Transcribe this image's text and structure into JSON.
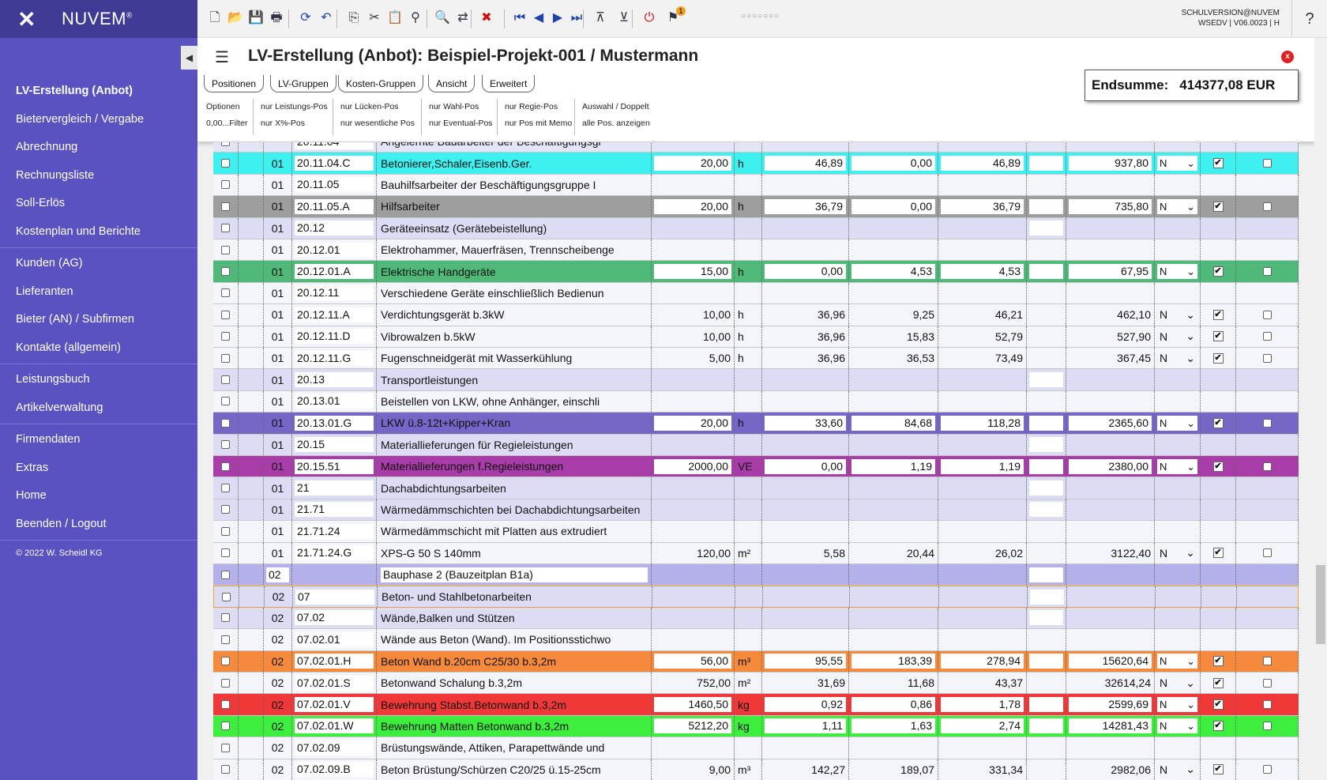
{
  "app": {
    "name": "NUVEM",
    "trademark": "®",
    "version_line1": "SCHULVERSION@NUVEM",
    "version_line2": "WSEDV | V06.0023 | H",
    "help": "?"
  },
  "page_title": "LV-Erstellung (Anbot): Beispiel-Projekt-001 / Mustermann",
  "close_label": "x",
  "endsum": {
    "label": "Endsumme:",
    "value": "414377,08 EUR"
  },
  "sidebar": {
    "groups": [
      [
        {
          "label": "LV-Erstellung (Anbot)",
          "active": true
        },
        {
          "label": "Bietervergleich / Vergabe"
        },
        {
          "label": "Abrechnung"
        },
        {
          "label": "Rechnungsliste"
        },
        {
          "label": "Soll-Erlös"
        },
        {
          "label": "Kostenplan und Berichte"
        }
      ],
      [
        {
          "label": "Kunden (AG)"
        },
        {
          "label": "Lieferanten"
        },
        {
          "label": "Bieter (AN) / Subfirmen"
        },
        {
          "label": "Kontakte (allgemein)"
        }
      ],
      [
        {
          "label": "Leistungsbuch"
        },
        {
          "label": "Artikelverwaltung"
        }
      ],
      [
        {
          "label": "Firmendaten"
        },
        {
          "label": "Extras"
        },
        {
          "label": "Home"
        },
        {
          "label": "Beenden / Logout"
        }
      ]
    ],
    "copyright": "© 2022 W. Scheidl KG"
  },
  "tabs": [
    "Positionen",
    "LV-Gruppen",
    "Kosten-Gruppen",
    "Ansicht",
    "Erweitert"
  ],
  "filters": [
    [
      "Optionen",
      "0,00...Filter"
    ],
    [
      "nur Leistungs-Pos",
      "nur X%-Pos"
    ],
    [
      "nur Lücken-Pos",
      "nur wesentliche Pos"
    ],
    [
      "nur Wahl-Pos",
      "nur Eventual-Pos"
    ],
    [
      "nur Regie-Pos",
      "nur Pos mit Memo"
    ],
    [
      "Auswahl / Doppelt",
      "alle Pos. anzeigen"
    ]
  ],
  "toolbar_icons": [
    "new-document-icon",
    "open-folder-icon",
    "save-icon",
    "print-icon",
    "refresh-icon",
    "undo-icon",
    "copy-icon",
    "cut-icon",
    "paste-icon",
    "binoculars-icon",
    "find-icon",
    "replace-icon",
    "delete-icon",
    "first-icon",
    "previous-icon",
    "next-icon",
    "last-icon",
    "expand-icon",
    "collapse-icon",
    "power-icon",
    "notification-icon"
  ],
  "toolbar_dots": "○○○○○○○",
  "notification_count": "1",
  "rows": [
    {
      "g": "",
      "oz": "20.11.04",
      "t": "Angelernte Bauarbeiter der Beschäftigungsgr",
      "bg": "#e4e4f6",
      "partial": true
    },
    {
      "g": "01",
      "oz": "20.11.04.C",
      "t": "Betonierer,Schaler,Eisenb.Ger.",
      "m": "20,00",
      "u": "h",
      "p1": "46,89",
      "p2": "0,00",
      "ep": "46,89",
      "gp": "937,80",
      "n": "N",
      "ck": true,
      "bg": "#3ef0f0",
      "type": "pos"
    },
    {
      "g": "01",
      "oz": "20.11.05",
      "t": "Bauhilfsarbeiter der Beschäftigungsgruppe I",
      "bg": "#f4f4fb",
      "type": "text"
    },
    {
      "g": "01",
      "oz": "20.11.05.A",
      "t": "Hilfsarbeiter",
      "m": "20,00",
      "u": "h",
      "p1": "36,79",
      "p2": "0,00",
      "ep": "36,79",
      "gp": "735,80",
      "n": "N",
      "ck": true,
      "bg": "#9e9e9e",
      "type": "pos"
    },
    {
      "g": "01",
      "oz": "20.12",
      "t": "Geräteeinsatz (Gerätebeistellung)",
      "bg": "#dcdcf4",
      "type": "group"
    },
    {
      "g": "01",
      "oz": "20.12.01",
      "t": "Elektrohammer, Mauerfräsen, Trennscheibenge",
      "bg": "#f4f4fb",
      "type": "text"
    },
    {
      "g": "01",
      "oz": "20.12.01.A",
      "t": "Elektrische Handgeräte",
      "m": "15,00",
      "u": "h",
      "p1": "0,00",
      "p2": "4,53",
      "ep": "4,53",
      "gp": "67,95",
      "n": "N",
      "ck": true,
      "bg": "#4fb97a",
      "type": "pos"
    },
    {
      "g": "01",
      "oz": "20.12.11",
      "t": "Verschiedene Geräte einschließlich Bedienun",
      "bg": "#f4f4fb",
      "type": "text"
    },
    {
      "g": "01",
      "oz": "20.12.11.A",
      "t": "Verdichtungsgerät b.3kW",
      "m": "10,00",
      "u": "h",
      "p1": "36,96",
      "p2": "9,25",
      "ep": "46,21",
      "gp": "462,10",
      "n": "N",
      "ck": true,
      "bg": "#f4f4fb",
      "type": "plain"
    },
    {
      "g": "01",
      "oz": "20.12.11.D",
      "t": "Vibrowalzen b.5kW",
      "m": "10,00",
      "u": "h",
      "p1": "36,96",
      "p2": "15,83",
      "ep": "52,79",
      "gp": "527,90",
      "n": "N",
      "ck": true,
      "bg": "#f4f4fb",
      "type": "plain"
    },
    {
      "g": "01",
      "oz": "20.12.11.G",
      "t": "Fugenschneidgerät mit Wasserkühlung",
      "m": "5,00",
      "u": "h",
      "p1": "36,96",
      "p2": "36,53",
      "ep": "73,49",
      "gp": "367,45",
      "n": "N",
      "ck": true,
      "bg": "#f4f4fb",
      "type": "plain"
    },
    {
      "g": "01",
      "oz": "20.13",
      "t": "Transportleistungen",
      "bg": "#dcdcf4",
      "type": "group"
    },
    {
      "g": "01",
      "oz": "20.13.01",
      "t": "Beistellen von LKW, ohne Anhänger, einschli",
      "bg": "#f4f4fb",
      "type": "text"
    },
    {
      "g": "01",
      "oz": "20.13.01.G",
      "t": "LKW ü.8-12t+Kipper+Kran",
      "m": "20,00",
      "u": "h",
      "p1": "33,60",
      "p2": "84,68",
      "ep": "118,28",
      "gp": "2365,60",
      "n": "N",
      "ck": true,
      "bg": "#7566c8",
      "type": "pos"
    },
    {
      "g": "01",
      "oz": "20.15",
      "t": "Materiallieferungen für Regieleistungen",
      "bg": "#dcdcf4",
      "type": "group"
    },
    {
      "g": "01",
      "oz": "20.15.51",
      "t": "Materiallieferungen f.Regieleistungen",
      "m": "2000,00",
      "u": "VE",
      "p1": "0,00",
      "p2": "1,19",
      "ep": "1,19",
      "gp": "2380,00",
      "n": "N",
      "ck": true,
      "bg": "#a83ca8",
      "type": "pos"
    },
    {
      "g": "01",
      "oz": "21",
      "t": "Dachabdichtungsarbeiten",
      "bg": "#dcdcf4",
      "type": "group"
    },
    {
      "g": "01",
      "oz": "21.71",
      "t": "Wärmedämmschichten bei Dachabdichtungsarbeiten",
      "bg": "#dcdcf4",
      "type": "group"
    },
    {
      "g": "01",
      "oz": "21.71.24",
      "t": "Wärmedämmschicht mit Platten aus extrudiert",
      "bg": "#f4f4fb",
      "type": "text"
    },
    {
      "g": "01",
      "oz": "21.71.24.G",
      "t": "XPS-G 50 S 140mm",
      "m": "120,00",
      "u": "m²",
      "p1": "5,58",
      "p2": "20,44",
      "ep": "26,02",
      "gp": "3122,40",
      "n": "N",
      "ck": true,
      "bg": "#f4f4fb",
      "type": "plain"
    },
    {
      "g": "02",
      "oz": "",
      "t": "Bauphase 2 (Bauzeitplan B1a)",
      "bg": "#b3b0ea",
      "type": "phase"
    },
    {
      "g": "02",
      "oz": "07",
      "t": "Beton- und Stahlbetonarbeiten",
      "bg": "#dcdcf4",
      "type": "group",
      "sel": true
    },
    {
      "g": "02",
      "oz": "07.02",
      "t": "Wände,Balken und Stützen",
      "bg": "#dcdcf4",
      "type": "group"
    },
    {
      "g": "02",
      "oz": "07.02.01",
      "t": "Wände aus Beton (Wand). Im Positionsstichwo",
      "bg": "#f4f4fb",
      "type": "text"
    },
    {
      "g": "02",
      "oz": "07.02.01.H",
      "t": "Beton Wand b.20cm C25/30 b.3,2m",
      "m": "56,00",
      "u": "m³",
      "p1": "95,55",
      "p2": "183,39",
      "ep": "278,94",
      "gp": "15620,64",
      "n": "N",
      "ck": true,
      "bg": "#f58a3c",
      "type": "pos"
    },
    {
      "g": "02",
      "oz": "07.02.01.S",
      "t": "Betonwand Schalung b.3,2m",
      "m": "752,00",
      "u": "m²",
      "p1": "31,69",
      "p2": "11,68",
      "ep": "43,37",
      "gp": "32614,24",
      "n": "N",
      "ck": true,
      "bg": "#f4f4fb",
      "type": "plain"
    },
    {
      "g": "02",
      "oz": "07.02.01.V",
      "t": "Bewehrung Stabst.Betonwand b.3,2m",
      "m": "1460,50",
      "u": "kg",
      "p1": "0,92",
      "p2": "0,86",
      "ep": "1,78",
      "gp": "2599,69",
      "n": "N",
      "ck": true,
      "bg": "#f03838",
      "type": "pos"
    },
    {
      "g": "02",
      "oz": "07.02.01.W",
      "t": "Bewehrung Matten Betonwand b.3,2m",
      "m": "5212,20",
      "u": "kg",
      "p1": "1,11",
      "p2": "1,63",
      "ep": "2,74",
      "gp": "14281,43",
      "n": "N",
      "ck": true,
      "bg": "#3eee3e",
      "type": "pos"
    },
    {
      "g": "02",
      "oz": "07.02.09",
      "t": "Brüstungswände, Attiken, Parapettwände und",
      "bg": "#f4f4fb",
      "type": "text"
    },
    {
      "g": "02",
      "oz": "07.02.09.B",
      "t": "Beton Brüstung/Schürzen C20/25 ü.15-25cm",
      "m": "9,00",
      "u": "m³",
      "p1": "142,27",
      "p2": "189,07",
      "ep": "331,34",
      "gp": "2982,06",
      "n": "N",
      "ck": true,
      "bg": "#f4f4fb",
      "type": "plain"
    }
  ]
}
